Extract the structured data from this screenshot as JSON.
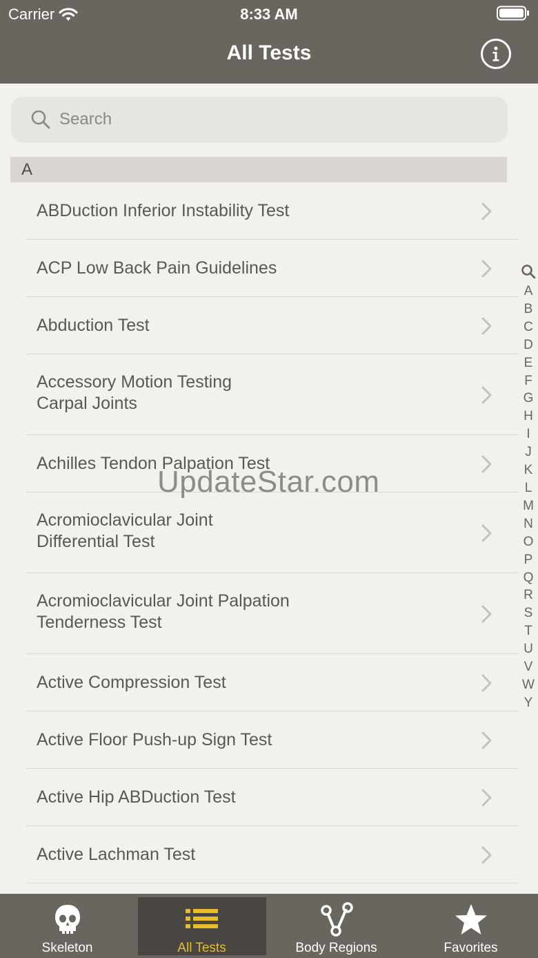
{
  "status_bar": {
    "carrier": "Carrier",
    "time": "8:33 AM",
    "wifi_icon": "wifi-icon",
    "battery_icon": "battery-icon"
  },
  "nav": {
    "title": "All Tests",
    "info_icon": "info-icon"
  },
  "search": {
    "placeholder": "Search",
    "value": "",
    "icon": "search-icon"
  },
  "section": {
    "letter": "A"
  },
  "items": [
    {
      "label": "ABDuction Inferior Instability Test"
    },
    {
      "label": "ACP Low Back Pain Guidelines"
    },
    {
      "label": "Abduction Test"
    },
    {
      "label": "Accessory Motion Testing\nCarpal Joints"
    },
    {
      "label": "Achilles Tendon Palpation Test"
    },
    {
      "label": "Acromioclavicular Joint\nDifferential Test"
    },
    {
      "label": "Acromioclavicular Joint Palpation\nTenderness Test"
    },
    {
      "label": "Active Compression Test"
    },
    {
      "label": "Active Floor Push-up Sign Test"
    },
    {
      "label": "Active Hip ABDuction Test"
    },
    {
      "label": "Active Lachman Test"
    }
  ],
  "index": {
    "letters": [
      "A",
      "B",
      "C",
      "D",
      "E",
      "F",
      "G",
      "H",
      "I",
      "J",
      "K",
      "L",
      "M",
      "N",
      "O",
      "P",
      "Q",
      "R",
      "S",
      "T",
      "U",
      "V",
      "W",
      "Y"
    ]
  },
  "watermark": "UpdateStar.com",
  "tabs": [
    {
      "label": "Skeleton",
      "icon": "skull-icon",
      "active": false
    },
    {
      "label": "All Tests",
      "icon": "list-icon",
      "active": true
    },
    {
      "label": "Body Regions",
      "icon": "body-regions-icon",
      "active": false
    },
    {
      "label": "Favorites",
      "icon": "star-icon",
      "active": false
    }
  ],
  "colors": {
    "header": "#69655f",
    "background": "#f2f1ed",
    "active_tab": "#e8bd2a"
  }
}
